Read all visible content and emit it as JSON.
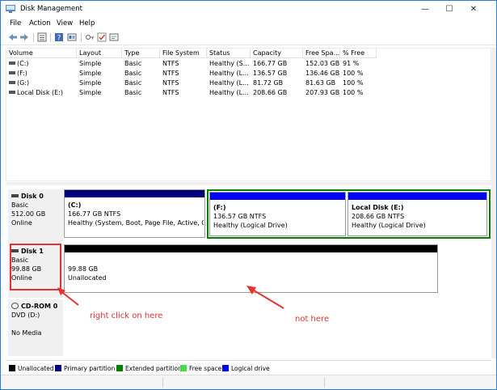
{
  "window": {
    "title": "Disk Management",
    "controls": {
      "minimize": "—",
      "maximize": "☐",
      "close": "✕"
    }
  },
  "menu": [
    "File",
    "Action",
    "View",
    "Help"
  ],
  "toolbar": {
    "buttons": [
      "back-arrow-icon",
      "forward-arrow-icon",
      "list-view-icon",
      "help-icon",
      "graphical-view-icon",
      "key-icon",
      "checkmark-icon",
      "properties-icon"
    ]
  },
  "volume_list": {
    "columns": [
      "Volume",
      "Layout",
      "Type",
      "File System",
      "Status",
      "Capacity",
      "Free Spa...",
      "% Free"
    ],
    "rows": [
      [
        "(C:)",
        "Simple",
        "Basic",
        "NTFS",
        "Healthy (S...",
        "166.77 GB",
        "152.03 GB",
        "91 %"
      ],
      [
        "(F:)",
        "Simple",
        "Basic",
        "NTFS",
        "Healthy (L...",
        "136.57 GB",
        "136.46 GB",
        "100 %"
      ],
      [
        "(G:)",
        "Simple",
        "Basic",
        "NTFS",
        "Healthy (L...",
        "81.72 GB",
        "81.63 GB",
        "100 %"
      ],
      [
        "Local Disk (E:)",
        "Simple",
        "Basic",
        "NTFS",
        "Healthy (L...",
        "208.66 GB",
        "207.93 GB",
        "100 %"
      ]
    ]
  },
  "disks": {
    "disk0": {
      "name": "Disk 0",
      "type": "Basic",
      "size": "512.00 GB",
      "status": "Online",
      "partitions": [
        {
          "name": "(C:)",
          "size": "166.77 GB NTFS",
          "status": "Healthy (System, Boot, Page File, Active, Crash"
        },
        {
          "name": "(F:)",
          "size": "136.57 GB NTFS",
          "status": "Healthy (Logical Drive)"
        },
        {
          "name": "Local Disk  (E:)",
          "size": "208.66 GB NTFS",
          "status": "Healthy (Logical Drive)"
        }
      ]
    },
    "disk1": {
      "name": "Disk 1",
      "type": "Basic",
      "size": "99.88 GB",
      "status": "Online",
      "unallocated_size": "99.88 GB",
      "unallocated_label": "Unallocated"
    },
    "cdrom0": {
      "name": "CD-ROM 0",
      "drive": "DVD (D:)",
      "media": "No Media"
    }
  },
  "legend": [
    {
      "label": "Unallocated",
      "color": "#000000"
    },
    {
      "label": "Primary partition",
      "color": "#00007f"
    },
    {
      "label": "Extended partition",
      "color": "#007f00"
    },
    {
      "label": "Free space",
      "color": "#3fe03f"
    },
    {
      "label": "Logical drive",
      "color": "#0000ff"
    }
  ],
  "annotations": {
    "right_click": "right click on here",
    "not_here": "not here",
    "color": "#e03030"
  }
}
